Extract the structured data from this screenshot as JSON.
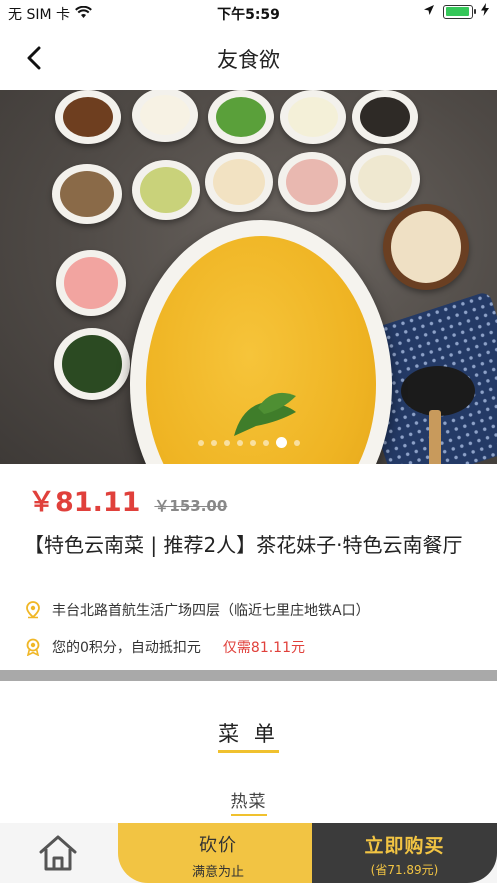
{
  "status_bar": {
    "carrier": "无 SIM 卡",
    "time": "下午5:59",
    "wifi_icon": "wifi-icon",
    "location_icon": "location-arrow-icon",
    "battery_icon": "battery-icon",
    "battery_level": 0.95,
    "charging_icon": "charging-bolt-icon"
  },
  "nav": {
    "back_icon": "chevron-left-icon",
    "title": "友食欲"
  },
  "banner": {
    "image_desc": "food-banner-image",
    "page_count": 8,
    "active_page": 7
  },
  "product": {
    "price": "￥81.11",
    "original_price": "￥153.00",
    "title": "【特色云南菜 | 推荐2人】茶花妹子·特色云南餐厅",
    "address_icon": "location-pin-icon",
    "address": "丰台北路首航生活广场四层（临近七里庄地铁A口）",
    "points_icon": "medal-icon",
    "points_text": "您的0积分，自动抵扣元",
    "need_text": "仅需81.11元"
  },
  "menu": {
    "title": "菜 单",
    "category": "热菜"
  },
  "bottom_bar": {
    "home_icon": "home-icon",
    "bargain_label": "砍价",
    "bargain_sub": "满意为止",
    "buy_label": "立即购买",
    "buy_sub": "(省71.89元)"
  },
  "colors": {
    "accent_yellow": "#f2c443",
    "price_red": "#e0403b",
    "buy_dark": "#3b3b3b"
  }
}
